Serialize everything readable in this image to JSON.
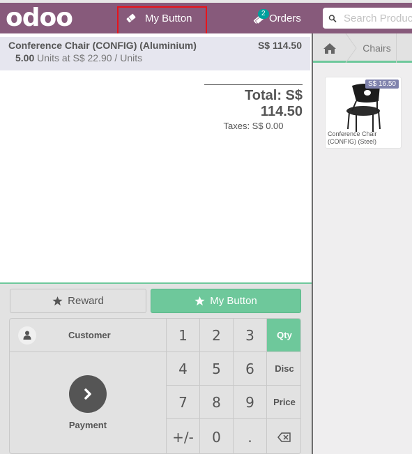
{
  "navbar": {
    "logo": "odoo",
    "custom_button_label": "My Button",
    "orders_label": "Orders",
    "orders_count": "2",
    "search_placeholder": "Search Products..."
  },
  "order": {
    "lines": [
      {
        "product": "Conference Chair (CONFIG) (Aluminium)",
        "price": "S$ 114.50",
        "qty": "5.00",
        "detail": "Units at S$ 22.90 / Units"
      }
    ],
    "total": "Total: S$ 114.50",
    "taxes": "Taxes: S$ 0.00"
  },
  "control_buttons": {
    "reward_label": "Reward",
    "my_button_label": "My Button"
  },
  "actionpad": {
    "customer_label": "Customer",
    "payment_label": "Payment"
  },
  "numpad": {
    "keys": [
      "1",
      "2",
      "3",
      "4",
      "5",
      "6",
      "7",
      "8",
      "9",
      "+/-",
      "0",
      "."
    ],
    "modes": [
      "Qty",
      "Disc",
      "Price"
    ],
    "active_mode": "Qty"
  },
  "categories": {
    "breadcrumb": [
      "Chairs"
    ]
  },
  "products": [
    {
      "name": "Conference Chair (CONFIG) (Steel)",
      "price": "S$ 16.50"
    }
  ],
  "colors": {
    "brand": "#875a7b",
    "accent_green": "#6ec89b",
    "badge": "#00a09d",
    "highlight": "#e8141b"
  }
}
